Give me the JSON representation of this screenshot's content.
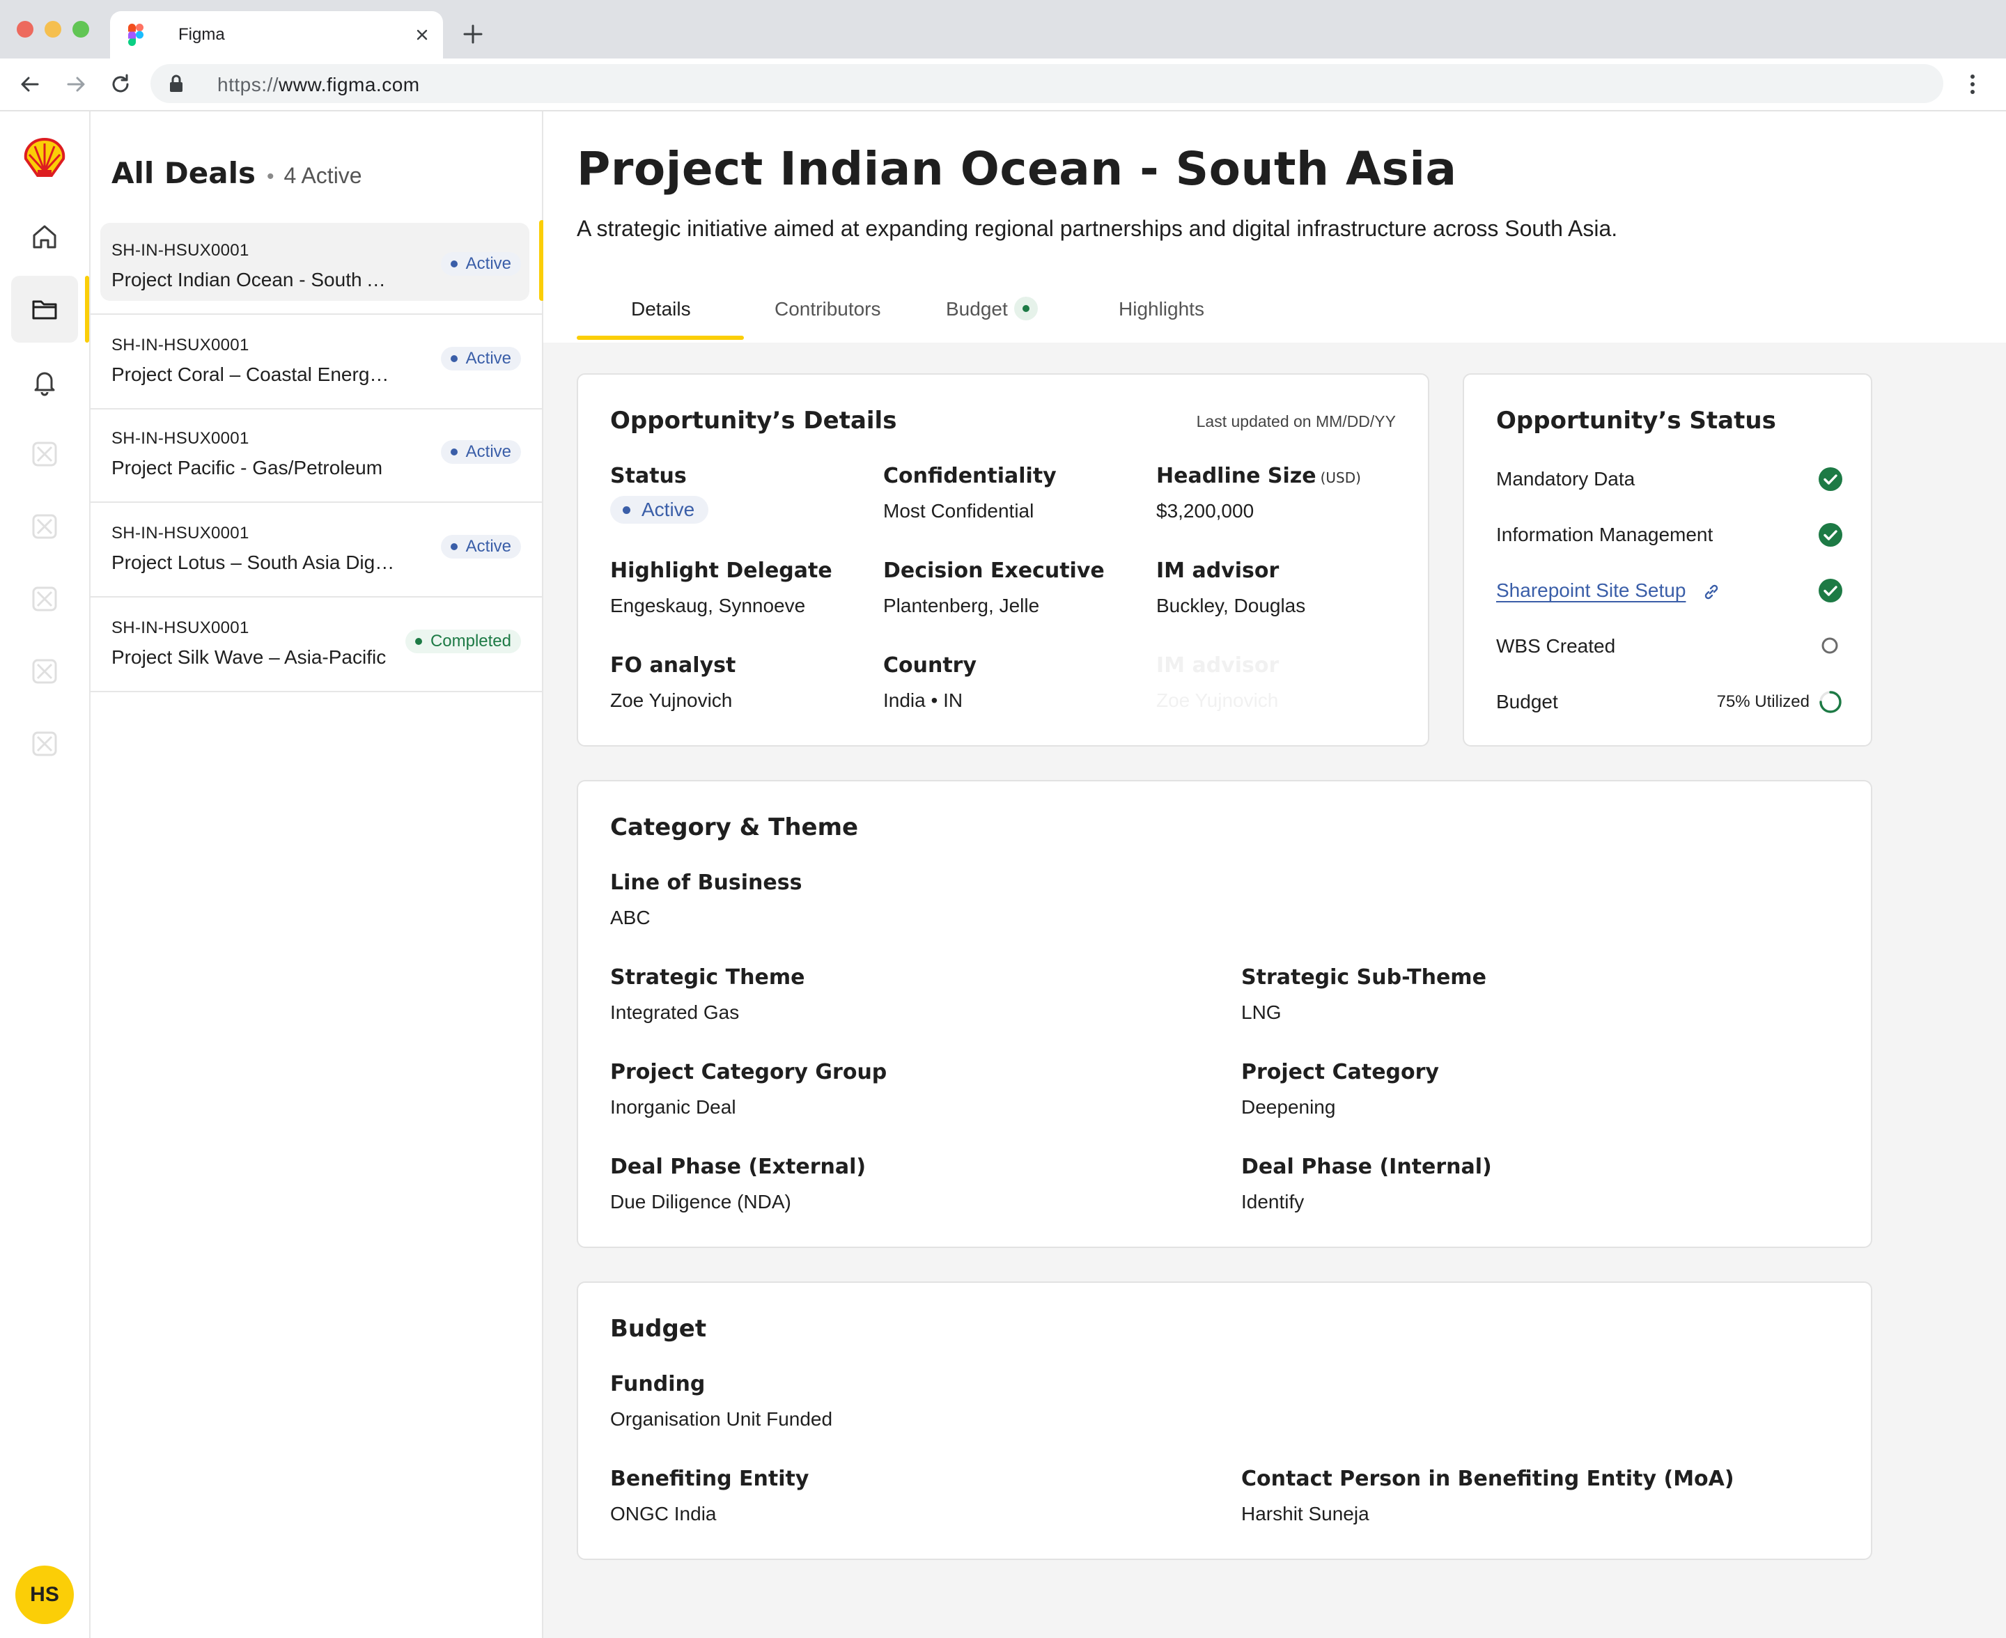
{
  "browser": {
    "tab_title": "Figma",
    "url_scheme": "https://",
    "url_host": "www.figma.com"
  },
  "colors": {
    "brand_yellow": "#fbce07",
    "brand_red": "#dd1d21",
    "active_blue": "#3a5ea8",
    "success_green": "#1d7a45"
  },
  "rail": {
    "items": [
      {
        "icon": "home-icon"
      },
      {
        "icon": "folder-icon",
        "active": true
      },
      {
        "icon": "bell-icon"
      }
    ],
    "avatar_initials": "HS"
  },
  "deals": {
    "title": "All Deals",
    "separator": "•",
    "count_label": "4 Active",
    "items": [
      {
        "id": "SH-IN-HSUX0001",
        "name": "Project Indian Ocean - South Asia",
        "status": "Active"
      },
      {
        "id": "SH-IN-HSUX0001",
        "name": "Project Coral – Coastal Energy Corridor",
        "status": "Active"
      },
      {
        "id": "SH-IN-HSUX0001",
        "name": "Project Pacific - Gas/Petroleum",
        "status": "Active"
      },
      {
        "id": "SH-IN-HSUX0001",
        "name": "Project Lotus – South Asia Digital",
        "status": "Active"
      },
      {
        "id": "SH-IN-HSUX0001",
        "name": "Project Silk Wave – Asia-Pacific",
        "status": "Completed"
      }
    ]
  },
  "project": {
    "title": "Project Indian Ocean - South Asia",
    "description": "A strategic initiative aimed at expanding regional partnerships and digital infrastructure across South Asia.",
    "tabs": [
      "Details",
      "Contributors",
      "Budget",
      "Highlights"
    ]
  },
  "details": {
    "title": "Opportunity’s Details",
    "last_updated": "Last updated on MM/DD/YY",
    "status_label": "Status",
    "status_value": "Active",
    "confidentiality_label": "Confidentiality",
    "confidentiality_value": "Most Confidential",
    "headline_label": "Headline Size",
    "headline_unit": "(USD)",
    "headline_value": "$3,200,000",
    "delegate_label": "Highlight Delegate",
    "delegate_value": "Engeskaug, Synnoeve",
    "executive_label": "Decision Executive",
    "executive_value": "Plantenberg, Jelle",
    "im_label": "IM advisor",
    "im_value": "Buckley, Douglas",
    "fo_label": "FO analyst",
    "fo_value": "Zoe Yujnovich",
    "country_label": "Country",
    "country_value": "India • IN",
    "ghost_label": "IM advisor",
    "ghost_value": "Zoe Yujnovich"
  },
  "opp_status": {
    "title": "Opportunity’s Status",
    "items": [
      {
        "label": "Mandatory Data",
        "state": "done"
      },
      {
        "label": "Information Management",
        "state": "done"
      },
      {
        "label": "Sharepoint Site Setup",
        "state": "done",
        "link": true
      },
      {
        "label": "WBS Created",
        "state": "pending"
      },
      {
        "label": "Budget",
        "state": "progress",
        "extra": "75% Utilized",
        "progress": 0.75
      }
    ]
  },
  "category": {
    "title": "Category & Theme",
    "lob_label": "Line of Business",
    "lob_value": "ABC",
    "theme_label": "Strategic Theme",
    "theme_value": "Integrated Gas",
    "subtheme_label": "Strategic Sub-Theme",
    "subtheme_value": "LNG",
    "group_label": "Project Category Group",
    "group_value": "Inorganic Deal",
    "pcat_label": "Project Category",
    "pcat_value": "Deepening",
    "ext_label": "Deal Phase (External)",
    "ext_value": "Due Diligence (NDA)",
    "int_label": "Deal Phase (Internal)",
    "int_value": "Identify"
  },
  "budget": {
    "title": "Budget",
    "funding_label": "Funding",
    "funding_value": "Organisation Unit Funded",
    "entity_label": "Benefiting Entity",
    "entity_value": "ONGC India",
    "contact_label": "Contact Person in Benefiting Entity (MoA)",
    "contact_value": "Harshit Suneja"
  }
}
